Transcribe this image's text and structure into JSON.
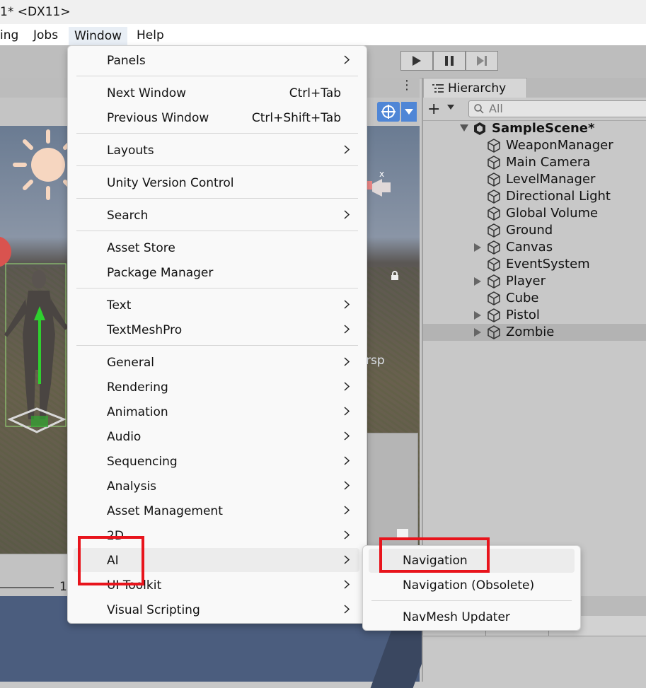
{
  "window": {
    "title": "1* <DX11>"
  },
  "menubar": {
    "items": [
      {
        "label": "ing"
      },
      {
        "label": "Jobs"
      },
      {
        "label": "Window"
      },
      {
        "label": "Help"
      }
    ]
  },
  "scene": {
    "view_label": "rsp",
    "zoom_value": "1"
  },
  "hierarchy": {
    "tab_label": "Hierarchy",
    "search_placeholder": "All",
    "scene_name": "SampleScene*",
    "objects": [
      {
        "name": "WeaponManager",
        "expandable": false
      },
      {
        "name": "Main Camera",
        "expandable": false
      },
      {
        "name": "LevelManager",
        "expandable": false
      },
      {
        "name": "Directional Light",
        "expandable": false
      },
      {
        "name": "Global Volume",
        "expandable": false
      },
      {
        "name": "Ground",
        "expandable": false
      },
      {
        "name": "Canvas",
        "expandable": true
      },
      {
        "name": "EventSystem",
        "expandable": false
      },
      {
        "name": "Player",
        "expandable": true
      },
      {
        "name": "Cube",
        "expandable": false
      },
      {
        "name": "Pistol",
        "expandable": true
      },
      {
        "name": "Zombie",
        "expandable": true,
        "selected": true
      }
    ]
  },
  "window_menu": {
    "items": [
      {
        "label": "Panels",
        "submenu": true
      },
      {
        "label": "Next Window",
        "shortcut": "Ctrl+Tab"
      },
      {
        "label": "Previous Window",
        "shortcut": "Ctrl+Shift+Tab"
      },
      {
        "label": "Layouts",
        "submenu": true
      },
      {
        "label": "Unity Version Control"
      },
      {
        "label": "Search",
        "submenu": true
      },
      {
        "label": "Asset Store"
      },
      {
        "label": "Package Manager"
      },
      {
        "label": "Text",
        "submenu": true
      },
      {
        "label": "TextMeshPro",
        "submenu": true
      },
      {
        "label": "General",
        "submenu": true
      },
      {
        "label": "Rendering",
        "submenu": true
      },
      {
        "label": "Animation",
        "submenu": true
      },
      {
        "label": "Audio",
        "submenu": true
      },
      {
        "label": "Sequencing",
        "submenu": true
      },
      {
        "label": "Analysis",
        "submenu": true
      },
      {
        "label": "Asset Management",
        "submenu": true
      },
      {
        "label": "2D",
        "submenu": true
      },
      {
        "label": "AI",
        "submenu": true,
        "highlighted": true
      },
      {
        "label": "UI Toolkit",
        "submenu": true
      },
      {
        "label": "Visual Scripting",
        "submenu": true
      }
    ]
  },
  "ai_submenu": {
    "items": [
      {
        "label": "Navigation",
        "highlighted": true
      },
      {
        "label": "Navigation (Obsolete)"
      },
      {
        "label": "NavMesh Updater"
      }
    ]
  },
  "colors": {
    "highlight_box": "#e8141c",
    "gizmo_accent": "#4f86d6"
  }
}
